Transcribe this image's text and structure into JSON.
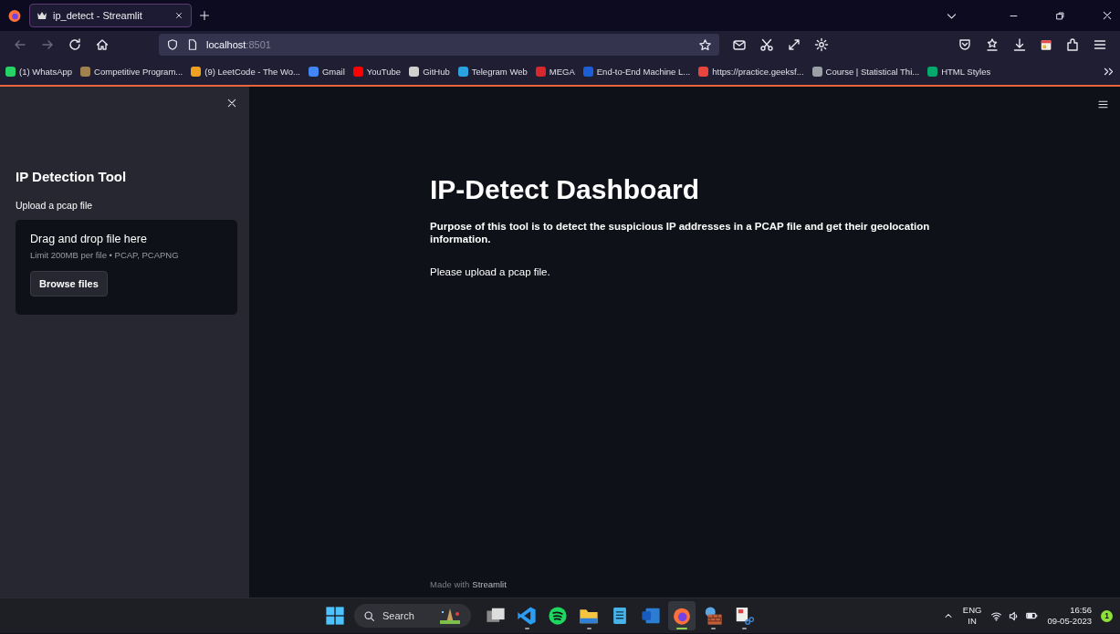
{
  "browser": {
    "tabs": [
      {
        "title": "ip_detect - Streamlit",
        "selected": true
      }
    ],
    "nav_buttons": [
      {
        "kind": "back",
        "disabled": true
      },
      {
        "kind": "forward",
        "disabled": true
      },
      {
        "kind": "reload",
        "disabled": false
      },
      {
        "kind": "home",
        "disabled": false
      }
    ],
    "url": {
      "host": "localhost",
      "port": ":8501"
    },
    "bookmarks": [
      {
        "label": "(1) WhatsApp",
        "color": "#25d366"
      },
      {
        "label": "Competitive Program...",
        "color": "#a0814f"
      },
      {
        "label": "(9) LeetCode - The Wo...",
        "color": "#f0a020"
      },
      {
        "label": "Gmail",
        "color": "#4285f4"
      },
      {
        "label": "YouTube",
        "color": "#ff0000"
      },
      {
        "label": "GitHub",
        "color": "#d0d0d0"
      },
      {
        "label": "Telegram Web",
        "color": "#2aa3e0"
      },
      {
        "label": "MEGA",
        "color": "#d9272e"
      },
      {
        "label": "End-to-End Machine L...",
        "color": "#1a5fd6"
      },
      {
        "label": "https://practice.geeksf...",
        "color": "#e8453c"
      },
      {
        "label": "Course | Statistical Thi...",
        "color": "#9aa0a6"
      },
      {
        "label": "HTML Styles",
        "color": "#04aa6d"
      }
    ]
  },
  "sidebar": {
    "title": "IP Detection Tool",
    "uploader": {
      "label": "Upload a pcap file",
      "drop_text": "Drag and drop file here",
      "limit": "Limit 200MB per file • PCAP, PCAPNG",
      "button": "Browse files"
    }
  },
  "main": {
    "title": "IP-Detect Dashboard",
    "description": "Purpose of this tool is to detect the suspicious IP addresses in a PCAP file and get their geolocation information.",
    "message": "Please upload a pcap file.",
    "footer": {
      "prefix": "Made with",
      "brand": "Streamlit"
    }
  },
  "taskbar": {
    "search": {
      "placeholder": "Search"
    },
    "apps": [
      {
        "kind": "windows",
        "running": false,
        "active": false
      },
      {
        "kind": "taskview",
        "running": false,
        "active": false
      },
      {
        "kind": "code",
        "running": true,
        "active": false
      },
      {
        "kind": "music",
        "running": false,
        "active": false
      },
      {
        "kind": "folder",
        "running": true,
        "active": false
      },
      {
        "kind": "notepad",
        "running": false,
        "active": false
      },
      {
        "kind": "word",
        "running": false,
        "active": false
      },
      {
        "kind": "browser",
        "running": true,
        "active": true
      },
      {
        "kind": "firewall",
        "running": true,
        "active": false
      },
      {
        "kind": "snip",
        "running": true,
        "active": false
      }
    ],
    "tray": {
      "language": "ENG",
      "region": "IN",
      "time": "16:56",
      "date": "09-05-2023",
      "notifications": "1"
    }
  }
}
